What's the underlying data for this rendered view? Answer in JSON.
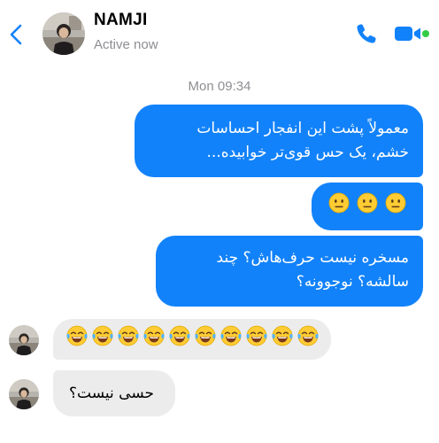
{
  "header": {
    "contact_name": "NAMJI",
    "status": "Active now",
    "back_icon": "chevron-left-icon",
    "call_icon": "phone-icon",
    "video_icon": "video-camera-icon"
  },
  "colors": {
    "accent": "#1282fa",
    "outgoing_bubble": "#1282fa",
    "incoming_bubble": "#ececec",
    "online_dot": "#31cc46",
    "muted_text": "#8e8e93"
  },
  "conversation": {
    "timestamp": "Mon 09:34",
    "messages": [
      {
        "direction": "out",
        "line1": "معمولاً پشت این انفجار احساسات",
        "line2": "خشم، یک حس قوی‌تر خوابیده..."
      },
      {
        "direction": "out",
        "emoji": "😐",
        "count": 3
      },
      {
        "direction": "out",
        "line1": "مسخره نیست حرف‌هاش؟ چند",
        "line2": "سالشه؟ نوجوونه؟"
      },
      {
        "direction": "in",
        "emoji": "😂",
        "count": 10
      },
      {
        "direction": "in",
        "text": "حسی نیست؟"
      }
    ]
  }
}
